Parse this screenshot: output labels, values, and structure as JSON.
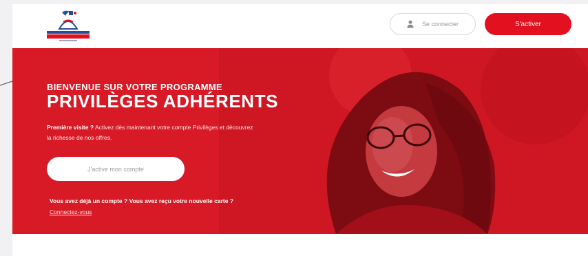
{
  "header": {
    "logo_alt": "logo",
    "login_label": "Se connecter",
    "activate_label": "S'activer"
  },
  "hero": {
    "subtitle": "BIENVENUE SUR VOTRE PROGRAMME",
    "title": "PRIVILÈGES ADHÉRENTS",
    "intro_bold": "Première visite ?",
    "intro_rest": " Activez dès maintenant votre compte Privilèges et découvrez la richesse de nos offres.",
    "cta_label": "J'active mon compte",
    "bottom_question": "Vous avez déjà un compte ? Vous avez reçu votre nouvelle carte ?",
    "bottom_link": "Connectez-vous"
  },
  "colors": {
    "brand_red": "#e3101f",
    "hero_red": "#d81a26",
    "background": "#f1f1f3"
  },
  "icons": [
    "user-icon",
    "logo-icon"
  ]
}
